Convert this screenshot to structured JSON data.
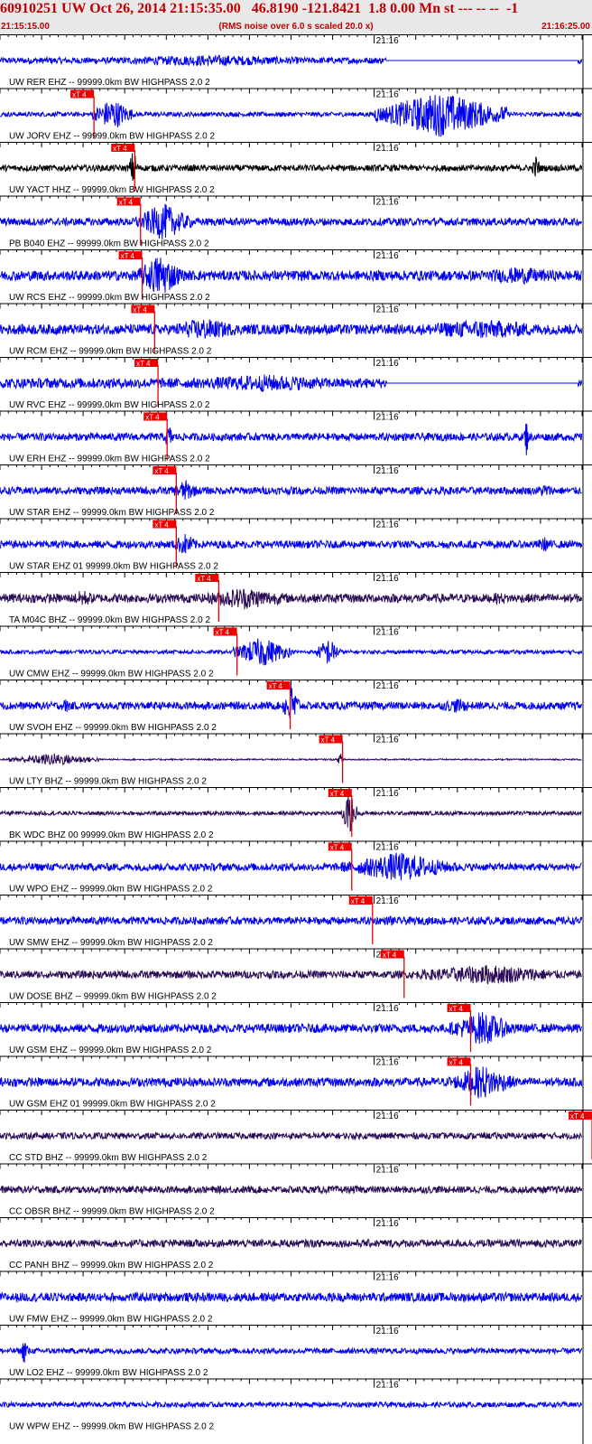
{
  "header": {
    "title": "60910251 UW Oct 26, 2014 21:15:35.00   46.8190 -121.8421  1.8 0.00 Mn st --- -- --  -1",
    "start_time": "21:15:15.00",
    "note": "(RMS noise over 6.0 s scaled 20.0 x)",
    "end_time": "21:16:25.00"
  },
  "chart_data": {
    "type": "line",
    "title": "60910251 UW Oct 26, 2014 21:15:35.00   46.8190 -121.8421  1.8 0.00 Mn st --- -- --  -1",
    "x_range": [
      "21:15:15.00",
      "21:16:25.00"
    ],
    "minute_tick_label": "21:16",
    "pick_label": "xT 4",
    "colors": {
      "blue": "#0000ee",
      "dark": "#2a0a55",
      "black": "#000000",
      "pick": "#ee0000"
    },
    "traces": [
      {
        "label": "UW RER EHZ -- 99999.0km BW  HIGHPASS  2.0  2",
        "color": "blue",
        "pick_s": null,
        "amp": 0.25,
        "events": [
          [
            5,
            46,
            0.45
          ],
          [
            70,
            84,
            0.5
          ]
        ],
        "gaps": [
          [
            46.5,
            69.5
          ]
        ]
      },
      {
        "label": "UW JORV EHZ -- 99999.0km BW  HIGHPASS  2.0  2",
        "color": "blue",
        "pick_s": 11.3,
        "amp": 0.18,
        "events": [
          [
            11,
            16,
            1.3
          ],
          [
            45,
            61,
            1.8
          ]
        ],
        "gaps": []
      },
      {
        "label": "UW YACT HHZ -- 99999.0km BW  HIGHPASS  2.0  2",
        "color": "black",
        "pick_s": 16.2,
        "amp": 0.25,
        "events": [
          [
            15.5,
            16.6,
            1.6
          ],
          [
            64,
            65,
            1.1
          ]
        ],
        "gaps": []
      },
      {
        "label": "PB B040 EHZ -- 99999.0km BW  HIGHPASS  2.0  2",
        "color": "blue",
        "pick_s": 16.9,
        "amp": 0.3,
        "events": [
          [
            16.3,
            23,
            1.5
          ]
        ],
        "gaps": []
      },
      {
        "label": "UW RCS EHZ -- 99999.0km BW  HIGHPASS  2.0  2",
        "color": "blue",
        "pick_s": 17.1,
        "amp": 0.4,
        "events": [
          [
            16.5,
            22,
            1.8
          ],
          [
            55,
            70,
            0.7
          ]
        ],
        "gaps": []
      },
      {
        "label": "UW RCM EHZ -- 99999.0km BW  HIGHPASS  2.0  2",
        "color": "blue",
        "pick_s": 18.6,
        "amp": 0.4,
        "events": [
          [
            19,
            30,
            0.9
          ],
          [
            46,
            70,
            0.8
          ]
        ],
        "gaps": []
      },
      {
        "label": "UW RVC EHZ -- 99999.0km BW  HIGHPASS  2.0  2",
        "color": "blue",
        "pick_s": 19.0,
        "amp": 0.4,
        "events": [
          [
            18,
            46,
            0.7
          ],
          [
            70,
            78,
            1.8
          ]
        ],
        "gaps": [
          [
            46.5,
            69.5
          ]
        ]
      },
      {
        "label": "UW ERH EHZ -- 99999.0km BW  HIGHPASS  2.0  2",
        "color": "blue",
        "pick_s": 20.1,
        "amp": 0.3,
        "events": [
          [
            19.6,
            21,
            1.0
          ],
          [
            63,
            63.6,
            1.6
          ]
        ],
        "gaps": []
      },
      {
        "label": "UW STAR EHZ -- 99999.0km BW  HIGHPASS  2.0  2",
        "color": "blue",
        "pick_s": 21.2,
        "amp": 0.3,
        "events": [
          [
            20.5,
            24,
            0.9
          ],
          [
            64,
            67,
            0.6
          ]
        ],
        "gaps": []
      },
      {
        "label": "UW STAR EHZ 01 99999.0km BW  HIGHPASS  2.0  2",
        "color": "blue",
        "pick_s": 21.2,
        "amp": 0.3,
        "events": [
          [
            20.5,
            24,
            0.9
          ],
          [
            64,
            67,
            0.6
          ]
        ],
        "gaps": []
      },
      {
        "label": "TA M04C BHZ -- 99999.0km BW  HIGHPASS  2.0  2",
        "color": "dark",
        "pick_s": 26.3,
        "amp": 0.35,
        "events": [
          [
            8,
            12,
            0.7
          ],
          [
            23,
            36,
            0.9
          ],
          [
            58,
            62,
            0.5
          ]
        ],
        "gaps": []
      },
      {
        "label": "UW CMW EHZ -- 99999.0km BW  HIGHPASS  2.0  2",
        "color": "blue",
        "pick_s": 28.5,
        "amp": 0.15,
        "events": [
          [
            28,
            35,
            1.2
          ],
          [
            38,
            41,
            1.1
          ]
        ],
        "gaps": []
      },
      {
        "label": "UW SVOH EHZ -- 99999.0km BW  HIGHPASS  2.0  2",
        "color": "blue",
        "pick_s": 34.9,
        "amp": 0.3,
        "events": [
          [
            7,
            9,
            0.6
          ],
          [
            34,
            36,
            1.9
          ],
          [
            52,
            58,
            0.6
          ]
        ],
        "gaps": []
      },
      {
        "label": "UW LTY BHZ -- 99999.0km BW  HIGHPASS  2.0  2",
        "color": "dark",
        "pick_s": 41.2,
        "amp": 0.06,
        "events": [
          [
            1,
            12,
            0.5
          ],
          [
            40.5,
            41.5,
            0.5
          ]
        ],
        "gaps": []
      },
      {
        "label": "BK WDC BHZ 00 99999.0km BW  HIGHPASS  2.0  2",
        "color": "dark",
        "pick_s": 42.3,
        "amp": 0.15,
        "events": [
          [
            41,
            43,
            1.7
          ]
        ],
        "gaps": []
      },
      {
        "label": "UW WPO EHZ -- 99999.0km BW  HIGHPASS  2.0  2",
        "color": "blue",
        "pick_s": 42.3,
        "amp": 0.3,
        "events": [
          [
            41,
            55,
            1.2
          ]
        ],
        "gaps": []
      },
      {
        "label": "UW SMW EHZ -- 99999.0km BW  HIGHPASS  2.0  2",
        "color": "blue",
        "pick_s": 44.8,
        "amp": 0.3,
        "events": [
          [
            46.5,
            47.5,
            0.6
          ]
        ],
        "gaps": []
      },
      {
        "label": "UW DOSE BHZ -- 99999.0km BW  HIGHPASS  2.0  2",
        "color": "dark",
        "pick_s": 48.6,
        "amp": 0.3,
        "events": [
          [
            47.5,
            70,
            0.8
          ]
        ],
        "gaps": []
      },
      {
        "label": "UW GSM EHZ -- 99999.0km BW  HIGHPASS  2.0  2",
        "color": "blue",
        "pick_s": 56.6,
        "amp": 0.35,
        "events": [
          [
            54,
            62,
            1.4
          ]
        ],
        "gaps": []
      },
      {
        "label": "UW GSM EHZ 01 99999.0km BW  HIGHPASS  2.0  2",
        "color": "blue",
        "pick_s": 56.6,
        "amp": 0.35,
        "events": [
          [
            54,
            62,
            1.4
          ]
        ],
        "gaps": []
      },
      {
        "label": "CC STD BHZ -- 99999.0km BW  HIGHPASS  2.0  2",
        "color": "dark",
        "pick_s": 71.2,
        "amp": 0.25,
        "events": [
          [
            69,
            72,
            0.5
          ]
        ],
        "gaps": []
      },
      {
        "label": "CC OBSR BHZ -- 99999.0km BW  HIGHPASS  2.0  2",
        "color": "dark",
        "pick_s": null,
        "amp": 0.28,
        "events": [],
        "gaps": []
      },
      {
        "label": "CC PANH BHZ -- 99999.0km BW  HIGHPASS  2.0  2",
        "color": "dark",
        "pick_s": null,
        "amp": 0.3,
        "events": [],
        "gaps": []
      },
      {
        "label": "UW FMW EHZ -- 99999.0km BW  HIGHPASS  2.0  2",
        "color": "blue",
        "pick_s": null,
        "amp": 0.35,
        "events": [],
        "gaps": []
      },
      {
        "label": "UW LO2 EHZ -- 99999.0km BW  HIGHPASS  2.0  2",
        "color": "blue",
        "pick_s": null,
        "amp": 0.22,
        "events": [
          [
            2.5,
            3.5,
            1.2
          ]
        ],
        "gaps": []
      },
      {
        "label": "UW WPW EHZ -- 99999.0km BW  HIGHPASS  2.0  2",
        "color": "blue",
        "pick_s": null,
        "amp": 0.2,
        "events": [],
        "gaps": []
      }
    ]
  }
}
